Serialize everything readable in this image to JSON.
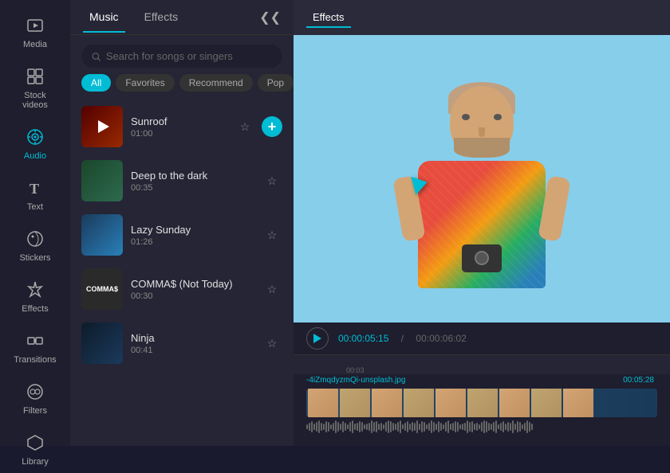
{
  "sidebar": {
    "items": [
      {
        "id": "media",
        "label": "Media",
        "icon": "▣"
      },
      {
        "id": "stock",
        "label": "Stock videos",
        "icon": "⊞"
      },
      {
        "id": "audio",
        "label": "Audio",
        "icon": "♪",
        "active": true
      },
      {
        "id": "text",
        "label": "Text",
        "icon": "T"
      },
      {
        "id": "stickers",
        "label": "Stickers",
        "icon": "◉"
      },
      {
        "id": "effects",
        "label": "Effects",
        "icon": "✦"
      },
      {
        "id": "transitions",
        "label": "Transitions",
        "icon": "⇄"
      },
      {
        "id": "filters",
        "label": "Filters",
        "icon": "◈"
      },
      {
        "id": "library",
        "label": "Library",
        "icon": "⬡"
      }
    ]
  },
  "panel": {
    "tab_music": "Music",
    "tab_effects": "Effects",
    "search_placeholder": "Search for songs or singers",
    "filters": [
      "All",
      "Favorites",
      "Recommend",
      "Pop"
    ],
    "active_filter": "All",
    "songs": [
      {
        "id": "sunroof",
        "title": "Sunroof",
        "duration": "01:00",
        "thumb_class": "thumb-sunroof"
      },
      {
        "id": "deep",
        "title": "Deep to the dark",
        "duration": "00:35",
        "thumb_class": "thumb-deep"
      },
      {
        "id": "lazy",
        "title": "Lazy Sunday",
        "duration": "01:26",
        "thumb_class": "thumb-lazy"
      },
      {
        "id": "comma",
        "title": "COMMA$ (Not Today)",
        "duration": "00:30",
        "thumb_class": "thumb-comma"
      },
      {
        "id": "ninja",
        "title": "Ninja",
        "duration": "00:41",
        "thumb_class": "thumb-ninja"
      }
    ]
  },
  "top_nav": {
    "items": [
      "Effects"
    ],
    "active": "Effects"
  },
  "timeline": {
    "play_time": "00:00:05:15",
    "total_time": "00:00:06:02",
    "marker": "00:03",
    "clip_label": "-4iZmqdyzmQi-unsplash.jpg",
    "clip_duration": "00:05:28"
  }
}
